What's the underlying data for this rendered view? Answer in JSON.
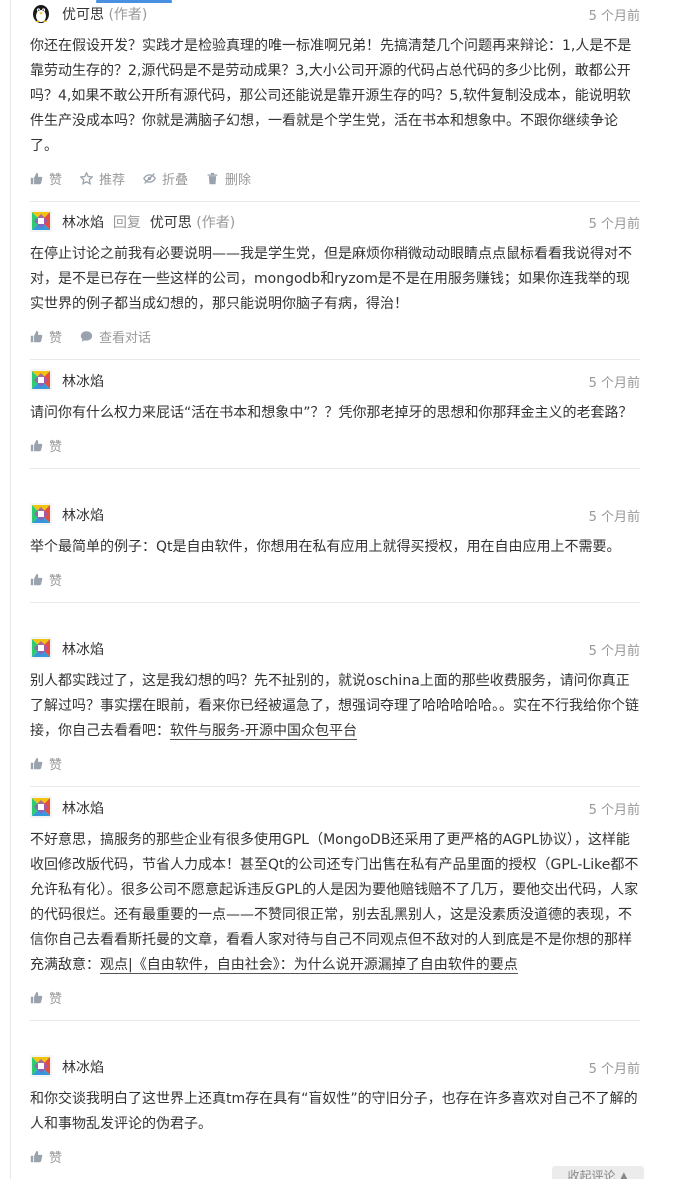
{
  "comments": [
    {
      "author": "优可思",
      "author_tag": "(作者)",
      "avatar": "penguin-avatar",
      "time": "5 个月前",
      "text": "你还在假设开发？实践才是检验真理的唯一标准啊兄弟！先搞清楚几个问题再来辩论：1,人是不是靠劳动生存的？2,源代码是不是劳动成果？3,大小公司开源的代码占总代码的多少比例，敢都公开吗？4,如果不敢公开所有源代码，那公司还能说是靠开源生存的吗？5,软件复制没成本，能说明软件生产没成本吗？你就是满脑子幻想，一看就是个学生党，活在书本和想象中。不跟你继续争论了。",
      "actions": {
        "like": "赞",
        "recommend": "推荐",
        "fold": "折叠",
        "delete": "删除"
      }
    },
    {
      "author": "林冰焰",
      "reply_word": "回复",
      "reply_to": "优可思",
      "reply_tag": "(作者)",
      "avatar": "colorful-avatar",
      "time": "5 个月前",
      "text": "在停止讨论之前我有必要说明——我是学生党，但是麻烦你稍微动动眼睛点点鼠标看看我说得对不对，是不是已存在一些这样的公司，mongodb和ryzom是不是在用服务赚钱；如果你连我举的现实世界的例子都当成幻想的，那只能说明你脑子有病，得治！",
      "actions": {
        "like": "赞",
        "view_conversation": "查看对话"
      }
    },
    {
      "author": "林冰焰",
      "avatar": "colorful-avatar",
      "time": "5 个月前",
      "text": "请问你有什么权力来屁话“活在书本和想象中”？？凭你那老掉牙的思想和你那拜金主义的老套路？",
      "actions": {
        "like": "赞"
      }
    },
    {
      "author": "林冰焰",
      "avatar": "colorful-avatar",
      "time": "5 个月前",
      "text": "举个最简单的例子：Qt是自由软件，你想用在私有应用上就得买授权，用在自由应用上不需要。",
      "actions": {
        "like": "赞"
      }
    },
    {
      "author": "林冰焰",
      "avatar": "colorful-avatar",
      "time": "5 个月前",
      "text": "别人都实践过了，这是我幻想的吗？先不扯别的，就说oschina上面的那些收费服务，请问你真正了解过吗？事实摆在眼前，看来你已经被逼急了，想强词夺理了哈哈哈哈哈。。实在不行我给你个链接，你自己去看看吧：",
      "link": "软件与服务-开源中国众包平台",
      "actions": {
        "like": "赞"
      }
    },
    {
      "author": "林冰焰",
      "avatar": "colorful-avatar",
      "time": "5 个月前",
      "text": "不好意思，搞服务的那些企业有很多使用GPL（MongoDB还采用了更严格的AGPL协议），这样能收回修改版代码，节省人力成本！甚至Qt的公司还专门出售在私有产品里面的授权（GPL-Like都不允许私有化）。很多公司不愿意起诉违反GPL的人是因为要他赔钱赔不了几万，要他交出代码，人家的代码很烂。还有最重要的一点——不赞同很正常，别去乱黑别人，这是没素质没道德的表现，不信你自己去看看斯托曼的文章，看看人家对待与自己不同观点但不敌对的人到底是不是你想的那样充满敌意：",
      "link": "观点|《自由软件，自由社会》：为什么说开源漏掉了自由软件的要点",
      "actions": {
        "like": "赞"
      }
    },
    {
      "author": "林冰焰",
      "avatar": "colorful-avatar",
      "time": "5 个月前",
      "text": "和你交谈我明白了这世界上还真tm存在具有“盲奴性”的守旧分子，也存在许多喜欢对自己不了解的人和事物乱发评论的伪君子。",
      "actions": {
        "like": "赞"
      }
    }
  ],
  "footer": {
    "collapse_label": "收起评论 ▲"
  }
}
